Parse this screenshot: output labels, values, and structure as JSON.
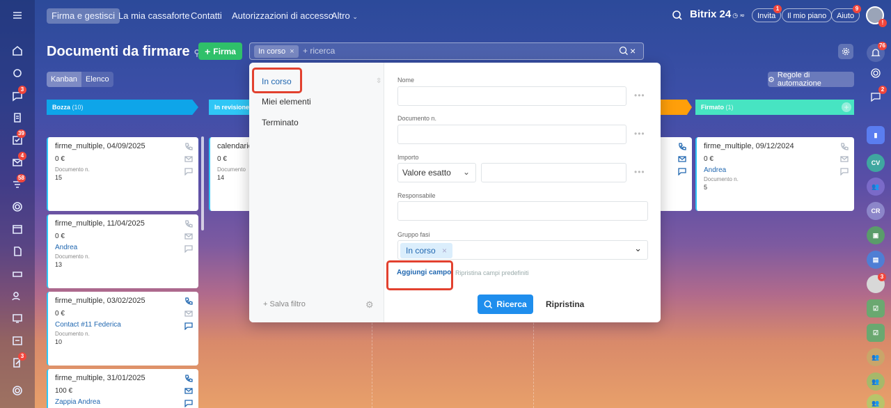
{
  "topnav": {
    "items": [
      "Firma e gestisci",
      "La mia cassaforte",
      "Contatti",
      "Autorizzazioni di accesso",
      "Altro"
    ],
    "brand": "Bitrix 24",
    "invita": "Invita",
    "invita_badge": "1",
    "piano": "Il mio piano",
    "aiuto": "Aiuto",
    "aiuto_badge": "9",
    "avatar_badge": "!"
  },
  "leftrail": {
    "badges": {
      "chat": "3",
      "tasks": "39",
      "mail": "4",
      "feed": "58",
      "edit": "3"
    }
  },
  "header": {
    "title": "Documenti da firmare",
    "firma_button": "Firma",
    "search_tag": "In corso",
    "search_placeholder": "+ ricerca",
    "view_kanban": "Kanban",
    "view_elenco": "Elenco",
    "automation": "Regole di automazione"
  },
  "columns": [
    {
      "name": "Bozza",
      "count": "(10)",
      "color": "#0ea5e9"
    },
    {
      "name": "In revisione",
      "count": "",
      "color": "#2fc6f6"
    },
    {
      "name": "",
      "count": "",
      "color": "#ff9f0a"
    },
    {
      "name": "Firmato",
      "count": "(1)",
      "color": "#47e4c2"
    }
  ],
  "cards_col1": [
    {
      "title": "firme_multiple, 04/09/2025",
      "price": "0 €",
      "who": "",
      "doclabel": "Documento n.",
      "docnum": "15"
    },
    {
      "title": "firme_multiple, 11/04/2025",
      "price": "0 €",
      "who": "Andrea",
      "doclabel": "Documento n.",
      "docnum": "13"
    },
    {
      "title": "firme_multiple, 03/02/2025",
      "price": "0 €",
      "who": "Contact #11 Federica",
      "doclabel": "Documento n.",
      "docnum": "10"
    },
    {
      "title": "firme_multiple, 31/01/2025",
      "price": "100 €",
      "who": "Zappia Andrea",
      "doclabel": "",
      "docnum": ""
    }
  ],
  "cards_col2": [
    {
      "title": "calendario",
      "price": "0 €",
      "doclabel": "Documento",
      "docnum": "14"
    }
  ],
  "cards_col4": [
    {
      "title": "firme_multiple, 09/12/2024",
      "price": "0 €",
      "who": "Andrea",
      "doclabel": "Documento n.",
      "docnum": "5"
    }
  ],
  "filter": {
    "presets": [
      "In corso",
      "Miei elementi",
      "Terminato"
    ],
    "save_filter": "+ Salva filtro",
    "fields": {
      "nome": "Nome",
      "documento": "Documento n.",
      "importo": "Importo",
      "importo_select": "Valore esatto",
      "responsabile": "Responsabile",
      "gruppo": "Gruppo fasi",
      "gruppo_tag": "In corso"
    },
    "add_field": "Aggiungi campo",
    "restore_fields": "Ripristina campi predefiniti",
    "search_button": "Ricerca",
    "reset_button": "Ripristina"
  },
  "rightrail": {
    "notif_badge": "76",
    "chat_badge": "2",
    "avatar_badge": "3",
    "cv": "CV",
    "cr": "CR"
  }
}
